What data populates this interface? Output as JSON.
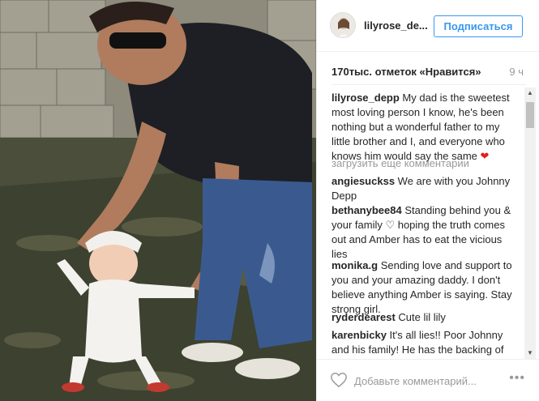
{
  "post": {
    "username": "lilyrose_de...",
    "follow_label": "Подписаться",
    "likes": "170тыс. отметок «Нравится»",
    "time": "9 ч"
  },
  "caption": {
    "user": "lilyrose_depp",
    "text": " My dad is the sweetest most loving person I know, he's been nothing but a wonderful father to my little brother and I, and everyone who knows him would say the same"
  },
  "load_more": "загрузить еще комментарии",
  "comments": [
    {
      "user": "angiesuckss",
      "text": " We are with you Johnny Depp"
    },
    {
      "user": "bethanybee84",
      "text": " Standing behind you & your family ♡ hoping the truth comes out and Amber has to eat the vicious lies"
    },
    {
      "user": "monika.g",
      "text": " Sending love and support to you and your amazing daddy. I don't believe anything Amber is saying. Stay strong girl."
    },
    {
      "user": "ryderdearest",
      "text": " Cute lil lily"
    },
    {
      "user": "karenbicky",
      "text": " It's all lies!! Poor Johnny and his family! He has the backing of millions"
    }
  ],
  "footer": {
    "comment_placeholder": "Добавьте комментарий...",
    "more_label": "•••"
  },
  "icons": {
    "heart": "heart-outline-icon",
    "heart_emoji": "red-heart-emoji"
  },
  "colors": {
    "accent": "#3897f0",
    "heart_red": "#e0201a",
    "muted": "#999999"
  }
}
